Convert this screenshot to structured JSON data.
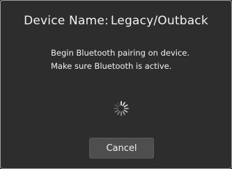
{
  "dialog": {
    "title_label": "Device Name:",
    "device_name": "Legacy/Outback",
    "message_line_1": "Begin Bluetooth pairing on device.",
    "message_line_2": "Make sure Bluetooth is active.",
    "spinner_icon": "loading-spinner-icon",
    "cancel_label": "Cancel"
  },
  "colors": {
    "background": "#2d2d2d",
    "border": "#a0a0a0",
    "text": "#f2f2f2",
    "button": "#4e4e4e"
  }
}
